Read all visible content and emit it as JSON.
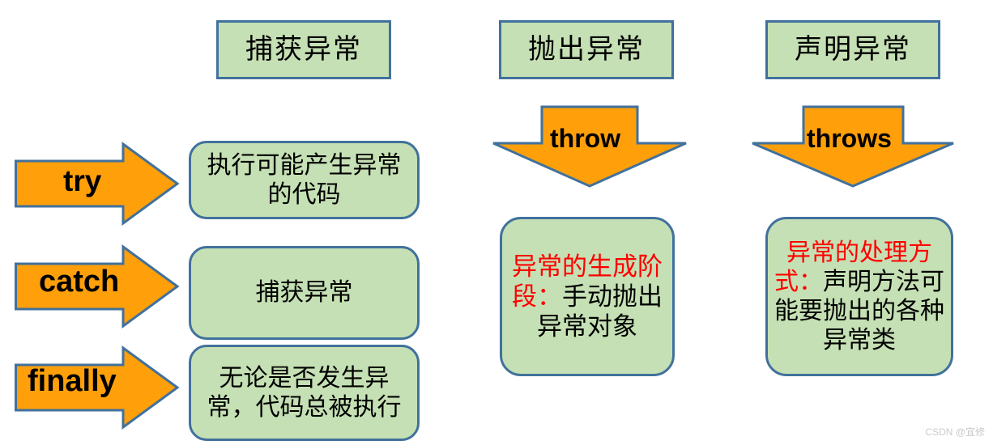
{
  "colors": {
    "box_fill": "#C5E0B4",
    "box_border": "#41719C",
    "arrow_fill": "#FFA00A",
    "arrow_border": "#41719C",
    "accent_text": "#FF0000",
    "body_text": "#000000",
    "background": "#FFFFFF",
    "watermark": "#C9C9C9"
  },
  "columns": {
    "catch": {
      "header": "捕获异常",
      "rows": [
        {
          "keyword": "try",
          "description": "执行可能产生异常的代码"
        },
        {
          "keyword": "catch",
          "description": "捕获异常"
        },
        {
          "keyword": "finally",
          "description": "无论是否发生异常，代码总被执行"
        }
      ]
    },
    "throw": {
      "header": "抛出异常",
      "arrow_label": "throw",
      "detail": {
        "accent": "异常的生成阶段：",
        "body": "手动抛出异常对象"
      }
    },
    "declare": {
      "header": "声明异常",
      "arrow_label": "throws",
      "detail": {
        "accent": "异常的处理方式：",
        "body": "声明方法可能要抛出的各种异常类"
      }
    }
  },
  "watermark": {
    "text": "CSDN @宜修"
  }
}
